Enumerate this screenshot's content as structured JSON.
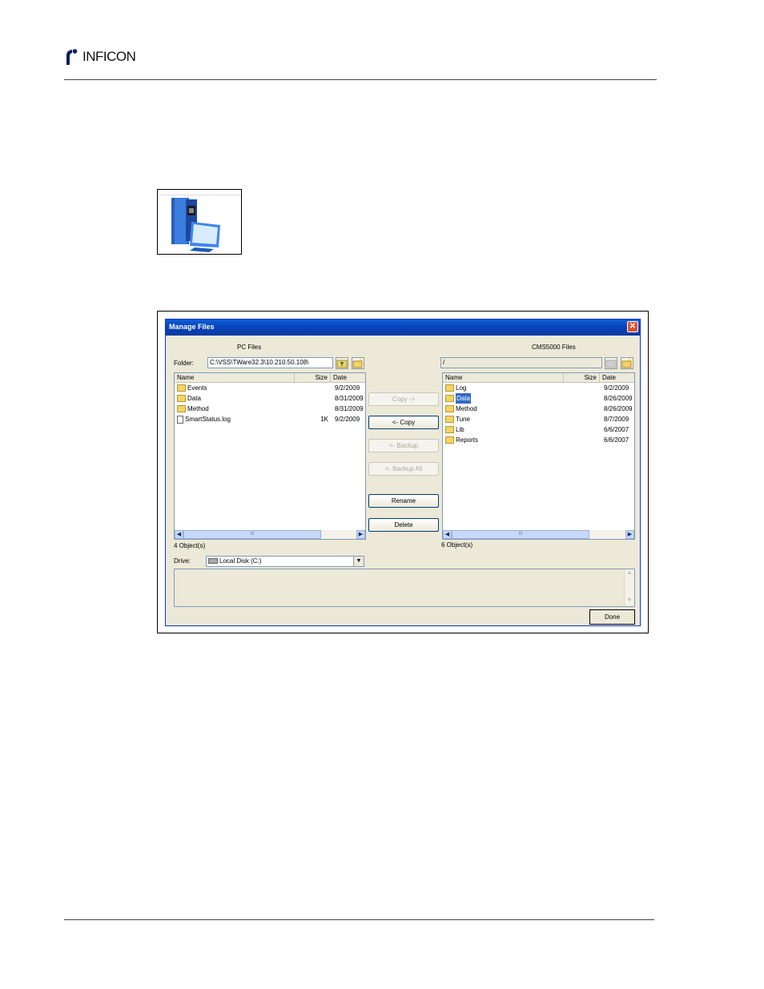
{
  "header": {
    "brand": "INFICON",
    "brand_color": "#0a1f5c"
  },
  "dialog": {
    "title": "Manage Files",
    "left_pane": {
      "heading": "PC Files",
      "folder_label": "Folder:",
      "folder_path": "C:\\VSS\\TWare32.3\\10.210.50.108\\",
      "columns": [
        "Name",
        "Size",
        "Date"
      ],
      "rows": [
        {
          "name": "Events",
          "type": "folder",
          "size": "",
          "date": "9/2/2009"
        },
        {
          "name": "Data",
          "type": "folder",
          "size": "",
          "date": "8/31/2009"
        },
        {
          "name": "Method",
          "type": "folder",
          "size": "",
          "date": "8/31/2009"
        },
        {
          "name": "SmartStatus.log",
          "type": "file",
          "size": "1K",
          "date": "9/2/2009"
        }
      ],
      "status": "4 Object(s)",
      "drive_label": "Drive:",
      "drive_value": "Local Disk (C:)"
    },
    "right_pane": {
      "heading": "CMS5000 Files",
      "folder_path": "/",
      "columns": [
        "Name",
        "Size",
        "Date"
      ],
      "rows": [
        {
          "name": "Log",
          "type": "folder",
          "size": "",
          "date": "9/2/2009",
          "selected": false
        },
        {
          "name": "Data",
          "type": "folder",
          "size": "",
          "date": "8/26/2009",
          "selected": true
        },
        {
          "name": "Method",
          "type": "folder",
          "size": "",
          "date": "8/26/2009",
          "selected": false
        },
        {
          "name": "Tune",
          "type": "folder",
          "size": "",
          "date": "8/7/2009",
          "selected": false
        },
        {
          "name": "Lib",
          "type": "folder",
          "size": "",
          "date": "6/6/2007",
          "selected": false
        },
        {
          "name": "Reports",
          "type": "folder",
          "size": "",
          "date": "6/6/2007",
          "selected": false
        }
      ],
      "status": "6 Object(s)"
    },
    "buttons": {
      "copy_right": "Copy ->",
      "copy_left": "<- Copy",
      "backup": "<- Backup",
      "backup_all": "<- Backup All",
      "rename": "Rename",
      "delete": "Delete",
      "done": "Done"
    },
    "scroll_thumb_glyph": "III"
  }
}
